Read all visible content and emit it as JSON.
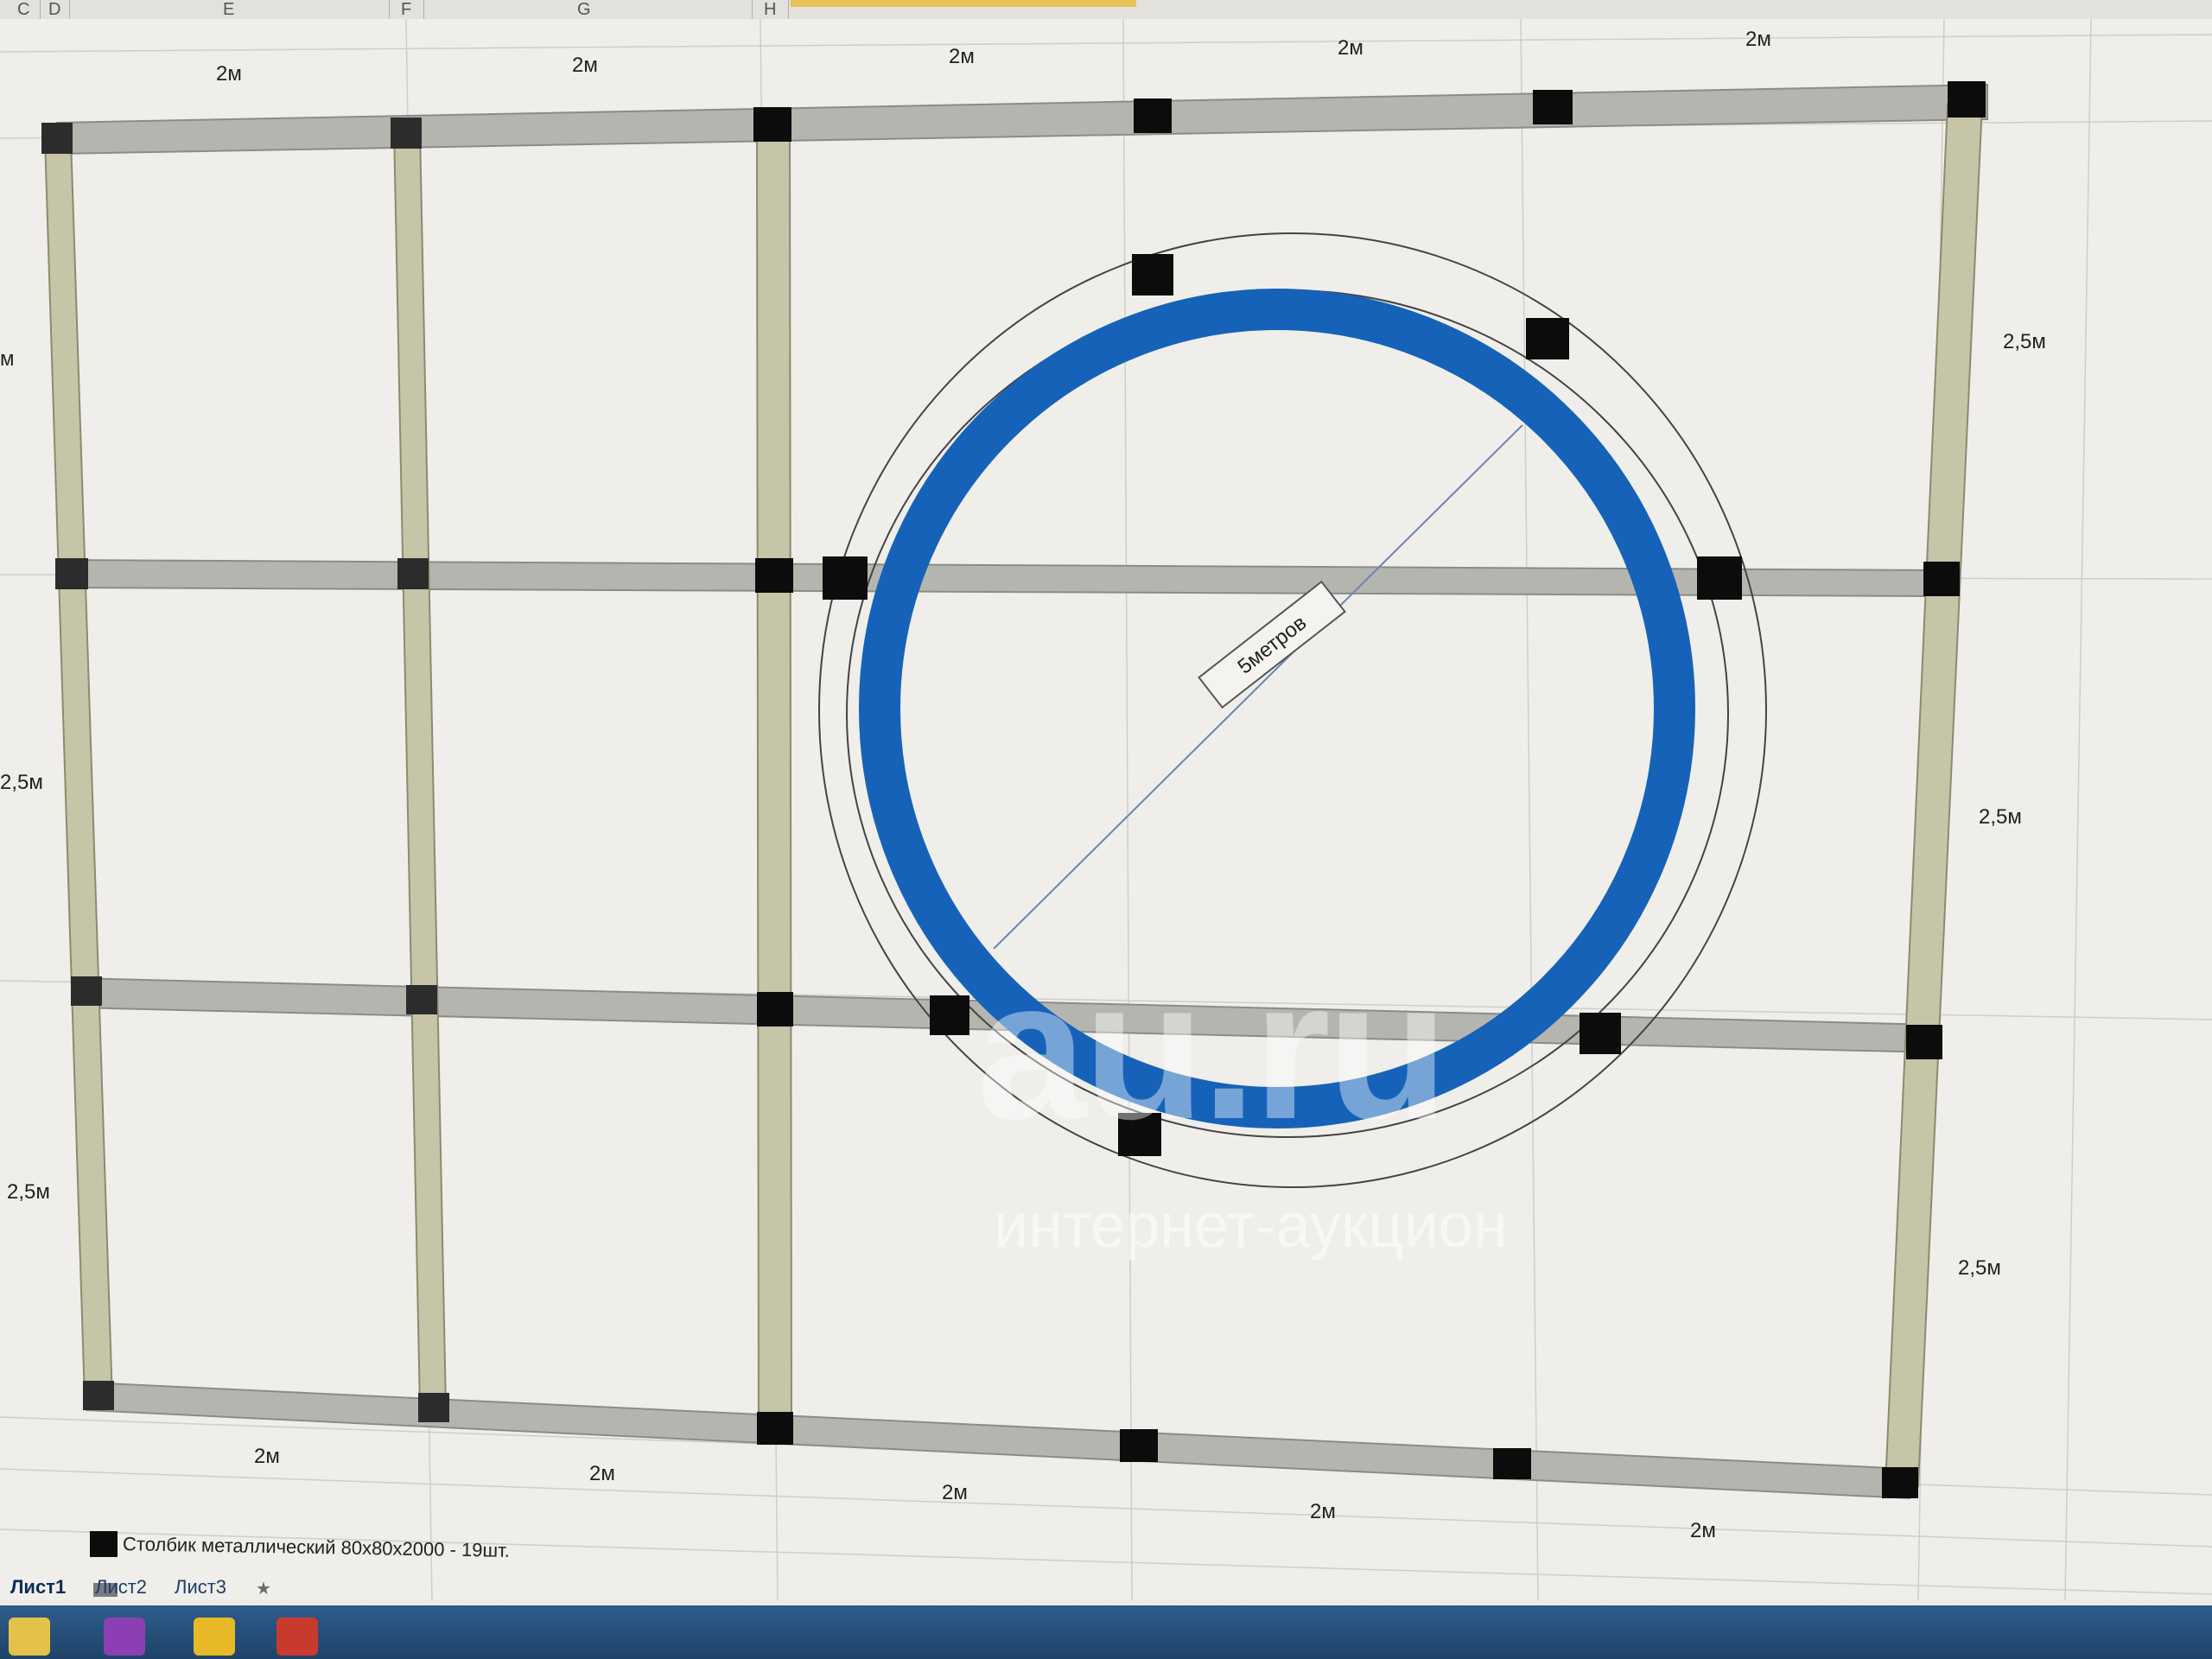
{
  "spreadsheet": {
    "columns": [
      "C",
      "D",
      "E",
      "F",
      "G",
      "H"
    ],
    "sheet_tabs": [
      "Лист1",
      "Лист2",
      "Лист3"
    ],
    "new_sheet_icon": "insert-sheet-icon"
  },
  "drawing": {
    "top_dimensions": [
      "2м",
      "2м",
      "2м",
      "2м",
      "2м"
    ],
    "bottom_dimensions": [
      "2м",
      "2м",
      "2м",
      "2м",
      "2м"
    ],
    "right_dimensions": [
      "2,5м",
      "2,5м",
      "2,5м"
    ],
    "left_dimensions": [
      "м",
      "2,5м",
      "2,5м"
    ],
    "circle_label": "5метров",
    "post_color": "#0c0c0c",
    "ring_color": "#1662b8",
    "beam_color": "#b5b5b0",
    "upright_color": "#c7c5a8"
  },
  "legend": {
    "post_text": "Столбик металлический 80х80х2000  -  19шт."
  },
  "watermark": {
    "logo": "au.ru",
    "subtitle": "интернет-аукцион"
  },
  "taskbar": {
    "icons": [
      "windows-icon",
      "taskbar-app-icon-1",
      "taskbar-app-icon-2",
      "taskbar-app-icon-3"
    ]
  }
}
